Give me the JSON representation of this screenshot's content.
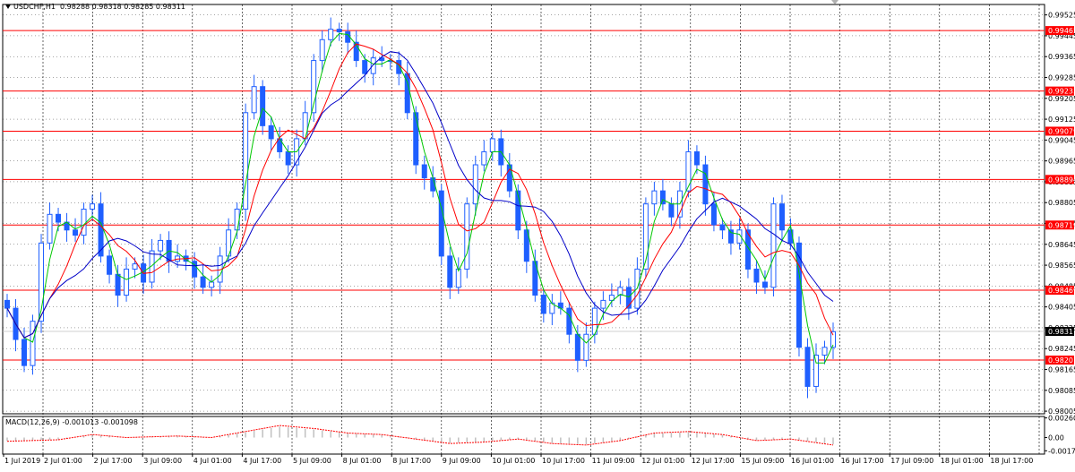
{
  "header": {
    "symbol": "USDCHF,H1",
    "ohlc": "0.98288 0.98318 0.98285 0.98311"
  },
  "macd": {
    "label": "MACD(12,26,9)",
    "values": "-0.001013 -0.001098"
  },
  "colors": {
    "background": "#ffffff",
    "grid": "#000000",
    "candles": "#1f5fff",
    "ma_fast": "#00c800",
    "ma_mid": "#ff0000",
    "ma_slow": "#0000c8",
    "hline": "#ff0000",
    "price_tag": "#ff0000",
    "current_tag": "#000000",
    "macd_hist": "#c0c0c0",
    "macd_signal": "#ff0000"
  },
  "chart_data": {
    "type": "candlestick",
    "symbol": "USDCHF",
    "timeframe": "H1",
    "y_ticks": [
      "0.99525",
      "0.99445",
      "0.99365",
      "0.99285",
      "0.99205",
      "0.99125",
      "0.99045",
      "0.98965",
      "0.98885",
      "0.98805",
      "0.98725",
      "0.98645",
      "0.98565",
      "0.98485",
      "0.98405",
      "0.98325",
      "0.98245",
      "0.98165",
      "0.98085",
      "0.98005"
    ],
    "ylim": [
      0.97995,
      0.99565
    ],
    "x_ticks": [
      "1 Jul 2019",
      "2 Jul 01:00",
      "2 Jul 17:00",
      "3 Jul 09:00",
      "4 Jul 01:00",
      "4 Jul 17:00",
      "5 Jul 09:00",
      "8 Jul 01:00",
      "8 Jul 17:00",
      "9 Jul 09:00",
      "10 Jul 01:00",
      "10 Jul 17:00",
      "11 Jul 09:00",
      "12 Jul 01:00",
      "12 Jul 17:00",
      "15 Jul 09:00",
      "16 Jul 01:00",
      "16 Jul 17:00",
      "17 Jul 09:00",
      "18 Jul 01:00",
      "18 Jul 17:00"
    ],
    "horizontal_levels": [
      "0.99465",
      "0.99233",
      "0.99079",
      "0.98894",
      "0.98719",
      "0.98469",
      "0.98201"
    ],
    "current_price": "0.98311",
    "close_path": [
      [
        0,
        0.984
      ],
      [
        1,
        0.9828
      ],
      [
        2,
        0.9818
      ],
      [
        3,
        0.9835
      ],
      [
        4,
        0.9865
      ],
      [
        5,
        0.9876
      ],
      [
        6,
        0.9873
      ],
      [
        7,
        0.987
      ],
      [
        8,
        0.9868
      ],
      [
        9,
        0.9878
      ],
      [
        10,
        0.988
      ],
      [
        11,
        0.986
      ],
      [
        12,
        0.9853
      ],
      [
        13,
        0.9845
      ],
      [
        14,
        0.9855
      ],
      [
        15,
        0.9857
      ],
      [
        16,
        0.985
      ],
      [
        17,
        0.9862
      ],
      [
        18,
        0.9866
      ],
      [
        19,
        0.9858
      ],
      [
        20,
        0.986
      ],
      [
        21,
        0.9858
      ],
      [
        22,
        0.9852
      ],
      [
        23,
        0.9848
      ],
      [
        24,
        0.985
      ],
      [
        25,
        0.986
      ],
      [
        26,
        0.987
      ],
      [
        27,
        0.9878
      ],
      [
        28,
        0.9915
      ],
      [
        29,
        0.9925
      ],
      [
        30,
        0.991
      ],
      [
        31,
        0.9905
      ],
      [
        32,
        0.99
      ],
      [
        33,
        0.9895
      ],
      [
        34,
        0.9905
      ],
      [
        35,
        0.9915
      ],
      [
        36,
        0.9935
      ],
      [
        37,
        0.9943
      ],
      [
        38,
        0.9947
      ],
      [
        39,
        0.9946
      ],
      [
        40,
        0.9942
      ],
      [
        41,
        0.9935
      ],
      [
        42,
        0.993
      ],
      [
        43,
        0.9936
      ],
      [
        44,
        0.9935
      ],
      [
        45,
        0.9935
      ],
      [
        46,
        0.993
      ],
      [
        47,
        0.9915
      ],
      [
        48,
        0.9895
      ],
      [
        49,
        0.989
      ],
      [
        50,
        0.9885
      ],
      [
        51,
        0.986
      ],
      [
        52,
        0.9848
      ],
      [
        53,
        0.9855
      ],
      [
        54,
        0.988
      ],
      [
        55,
        0.9895
      ],
      [
        56,
        0.99
      ],
      [
        57,
        0.9905
      ],
      [
        58,
        0.9895
      ],
      [
        59,
        0.9885
      ],
      [
        60,
        0.987
      ],
      [
        61,
        0.9858
      ],
      [
        62,
        0.9845
      ],
      [
        63,
        0.9838
      ],
      [
        64,
        0.9842
      ],
      [
        65,
        0.984
      ],
      [
        66,
        0.983
      ],
      [
        67,
        0.982
      ],
      [
        68,
        0.983
      ],
      [
        69,
        0.984
      ],
      [
        70,
        0.9843
      ],
      [
        71,
        0.9845
      ],
      [
        72,
        0.9848
      ],
      [
        73,
        0.984
      ],
      [
        74,
        0.9855
      ],
      [
        75,
        0.988
      ],
      [
        76,
        0.9885
      ],
      [
        77,
        0.988
      ],
      [
        78,
        0.9875
      ],
      [
        79,
        0.9885
      ],
      [
        80,
        0.99
      ],
      [
        81,
        0.9895
      ],
      [
        82,
        0.988
      ],
      [
        83,
        0.9872
      ],
      [
        84,
        0.987
      ],
      [
        85,
        0.9865
      ],
      [
        86,
        0.987
      ],
      [
        87,
        0.9855
      ],
      [
        88,
        0.985
      ],
      [
        89,
        0.9848
      ],
      [
        90,
        0.988
      ],
      [
        91,
        0.987
      ],
      [
        92,
        0.9865
      ],
      [
        93,
        0.9825
      ],
      [
        94,
        0.981
      ],
      [
        95,
        0.9822
      ],
      [
        96,
        0.9825
      ],
      [
        97,
        0.9831
      ]
    ],
    "macd_ticks": [
      "0.002608",
      "0.00",
      "-0.001761"
    ],
    "macd_ylim": [
      -0.0022,
      0.0028
    ],
    "macd_signal_path": [
      [
        0,
        -0.0005
      ],
      [
        6,
        -0.0003
      ],
      [
        10,
        0.0004
      ],
      [
        14,
        0.0
      ],
      [
        20,
        0.0002
      ],
      [
        24,
        0.0
      ],
      [
        28,
        0.0008
      ],
      [
        32,
        0.0016
      ],
      [
        36,
        0.0012
      ],
      [
        40,
        0.0006
      ],
      [
        44,
        0.0004
      ],
      [
        48,
        -0.0002
      ],
      [
        52,
        -0.0008
      ],
      [
        56,
        -0.0006
      ],
      [
        60,
        -0.0002
      ],
      [
        64,
        -0.0008
      ],
      [
        68,
        -0.001
      ],
      [
        72,
        -0.0004
      ],
      [
        76,
        0.0006
      ],
      [
        80,
        0.0008
      ],
      [
        84,
        0.0004
      ],
      [
        88,
        -0.0004
      ],
      [
        92,
        -0.0002
      ],
      [
        97,
        -0.001
      ]
    ]
  }
}
